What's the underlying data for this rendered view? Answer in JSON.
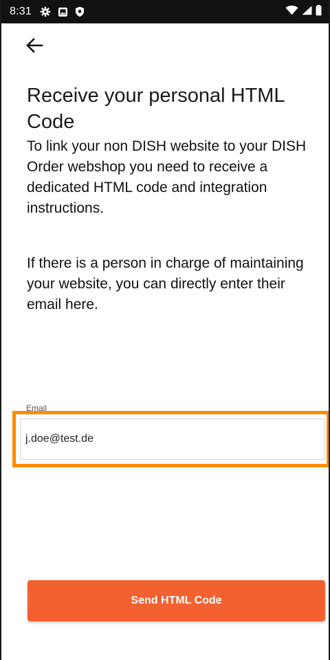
{
  "status_bar": {
    "time": "8:31",
    "left_icons": [
      "settings-icon",
      "photo-icon",
      "shield-icon"
    ],
    "right_icons": [
      "wifi-icon",
      "cellular-signal-icon",
      "battery-icon"
    ]
  },
  "navigation": {
    "back_icon": "arrow-left-icon"
  },
  "content": {
    "title": "Receive your personal HTML Code",
    "intro": "To link your non DISH website to your DISH Order webshop you need to receive a dedicated HTML code and integration instructions.",
    "helper": "If there is a person in charge of maintaining your website, you can directly enter their email here."
  },
  "form": {
    "email_label": "Email",
    "email_value": "j.doe@test.de",
    "highlight_color": "#ff8c00"
  },
  "actions": {
    "send_label": "Send HTML Code",
    "send_color": "#f2612f"
  }
}
